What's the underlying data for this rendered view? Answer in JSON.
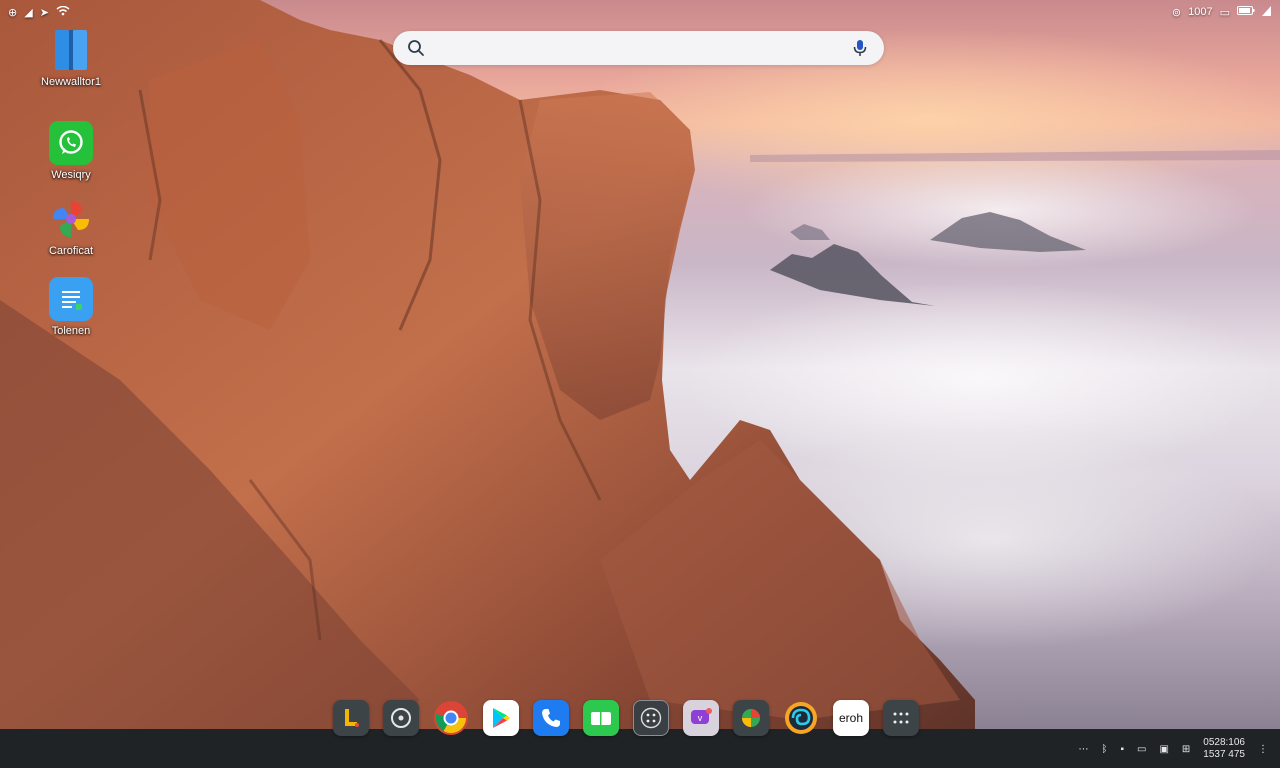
{
  "status_bar": {
    "left_text": "⊕",
    "right_text": "1007"
  },
  "search": {
    "placeholder": ""
  },
  "desktop_icons": [
    {
      "label": "Newwalltor1",
      "icon": "document-split-icon",
      "color": "#2e8ee6"
    },
    {
      "label": "Wesiqry",
      "icon": "whatsapp-icon",
      "color": "#25c13b"
    },
    {
      "label": "Caroficat",
      "icon": "photos-pinwheel-icon",
      "color": "#ffffff"
    },
    {
      "label": "Tolenen",
      "icon": "notes-icon",
      "color": "#3aa0f2"
    }
  ],
  "dock": {
    "apps": [
      {
        "name": "launcher",
        "icon": "launcher-l-icon"
      },
      {
        "name": "circle",
        "icon": "circle-target-icon"
      },
      {
        "name": "chrome",
        "icon": "chrome-icon"
      },
      {
        "name": "play-store",
        "icon": "play-store-icon"
      },
      {
        "name": "phone",
        "icon": "phone-icon"
      },
      {
        "name": "meet",
        "icon": "video-meet-icon"
      },
      {
        "name": "apps-grid",
        "icon": "dots-grid-icon"
      },
      {
        "name": "messenger",
        "icon": "chat-bubble-icon"
      },
      {
        "name": "colorful",
        "icon": "colorful-cube-icon"
      },
      {
        "name": "browser",
        "icon": "spiral-browser-icon"
      },
      {
        "name": "text-app",
        "icon": "text-tile-icon",
        "label": "eroh"
      },
      {
        "name": "all-apps",
        "icon": "app-drawer-icon"
      }
    ]
  },
  "tray": {
    "clock_top": "0528:106",
    "clock_bottom": "1537 475"
  },
  "colors": {
    "taskbar": "#1f2326",
    "search_bg": "#f4f4f6",
    "whatsapp_green": "#25c13b",
    "meet_green": "#2cc94e",
    "phone_blue": "#1e7cf0"
  }
}
